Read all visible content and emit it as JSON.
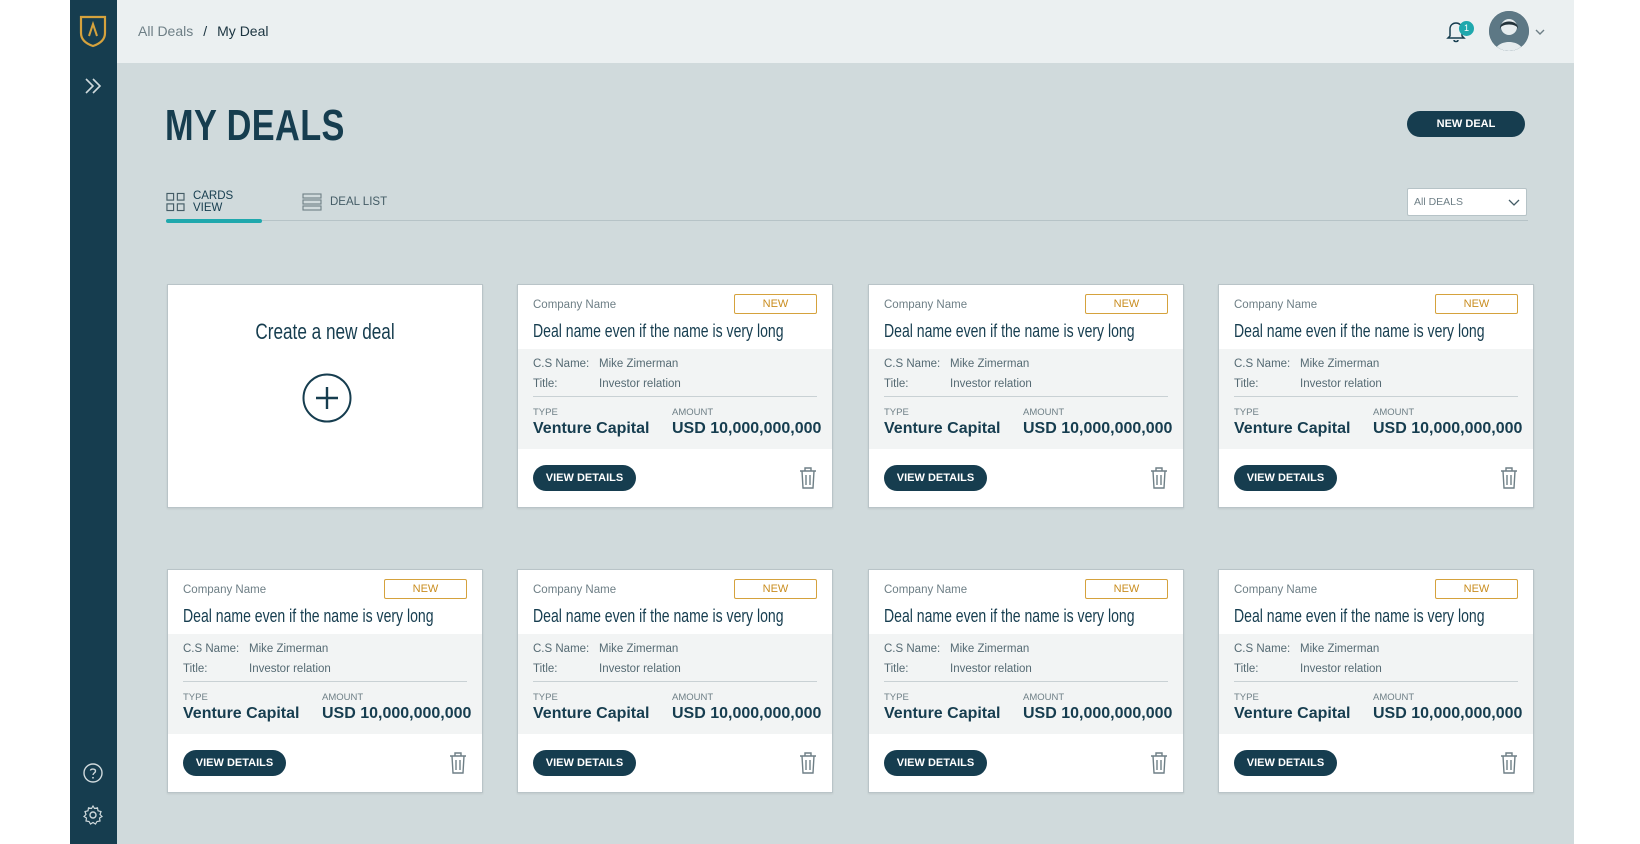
{
  "breadcrumb": {
    "parent": "All Deals",
    "separator": "/",
    "current": "My Deal"
  },
  "notifications": {
    "count": "1"
  },
  "page": {
    "title": "MY DEALS",
    "new_deal_label": "NEW DEAL"
  },
  "tabs": [
    {
      "label": "CARDS VIEW",
      "icon": "grid-icon",
      "active": true
    },
    {
      "label": "DEAL LIST",
      "icon": "list-icon",
      "active": false
    }
  ],
  "filter": {
    "selected": "All DEALS"
  },
  "create_card": {
    "title": "Create a new deal"
  },
  "deals": [
    {
      "company": "Company Name",
      "badge": "NEW",
      "name": "Deal name even if the name is very long",
      "cs_label": "C.S Name:",
      "cs_name": "Mike Zimerman",
      "title_label": "Title:",
      "title": "Investor relation",
      "type_label": "TYPE",
      "type": "Venture Capital",
      "amount_label": "AMOUNT",
      "amount": "USD 10,000,000,000",
      "view_label": "VIEW DETAILS"
    },
    {
      "company": "Company Name",
      "badge": "NEW",
      "name": "Deal name even if the name is very long",
      "cs_label": "C.S Name:",
      "cs_name": "Mike Zimerman",
      "title_label": "Title:",
      "title": "Investor relation",
      "type_label": "TYPE",
      "type": "Venture Capital",
      "amount_label": "AMOUNT",
      "amount": "USD 10,000,000,000",
      "view_label": "VIEW DETAILS"
    },
    {
      "company": "Company Name",
      "badge": "NEW",
      "name": "Deal name even if the name is very long",
      "cs_label": "C.S Name:",
      "cs_name": "Mike Zimerman",
      "title_label": "Title:",
      "title": "Investor relation",
      "type_label": "TYPE",
      "type": "Venture Capital",
      "amount_label": "AMOUNT",
      "amount": "USD 10,000,000,000",
      "view_label": "VIEW DETAILS"
    },
    {
      "company": "Company Name",
      "badge": "NEW",
      "name": "Deal name even if the name is very long",
      "cs_label": "C.S Name:",
      "cs_name": "Mike Zimerman",
      "title_label": "Title:",
      "title": "Investor relation",
      "type_label": "TYPE",
      "type": "Venture Capital",
      "amount_label": "AMOUNT",
      "amount": "USD 10,000,000,000",
      "view_label": "VIEW DETAILS"
    },
    {
      "company": "Company Name",
      "badge": "NEW",
      "name": "Deal name even if the name is very long",
      "cs_label": "C.S Name:",
      "cs_name": "Mike Zimerman",
      "title_label": "Title:",
      "title": "Investor relation",
      "type_label": "TYPE",
      "type": "Venture Capital",
      "amount_label": "AMOUNT",
      "amount": "USD 10,000,000,000",
      "view_label": "VIEW DETAILS"
    },
    {
      "company": "Company Name",
      "badge": "NEW",
      "name": "Deal name even if the name is very long",
      "cs_label": "C.S Name:",
      "cs_name": "Mike Zimerman",
      "title_label": "Title:",
      "title": "Investor relation",
      "type_label": "TYPE",
      "type": "Venture Capital",
      "amount_label": "AMOUNT",
      "amount": "USD 10,000,000,000",
      "view_label": "VIEW DETAILS"
    },
    {
      "company": "Company Name",
      "badge": "NEW",
      "name": "Deal name even if the name is very long",
      "cs_label": "C.S Name:",
      "cs_name": "Mike Zimerman",
      "title_label": "Title:",
      "title": "Investor relation",
      "type_label": "TYPE",
      "type": "Venture Capital",
      "amount_label": "AMOUNT",
      "amount": "USD 10,000,000,000",
      "view_label": "VIEW DETAILS"
    }
  ],
  "colors": {
    "sidebar": "#163d4f",
    "accent": "#1fa8ad",
    "badge": "#d5a23d",
    "background": "#d0dadc"
  },
  "icons": {
    "logo": "shield-logo-icon",
    "expand": "double-chevron-right-icon",
    "help": "help-circle-icon",
    "settings": "gear-icon",
    "bell": "bell-icon",
    "trash": "trash-icon",
    "plus": "plus-circle-icon"
  }
}
